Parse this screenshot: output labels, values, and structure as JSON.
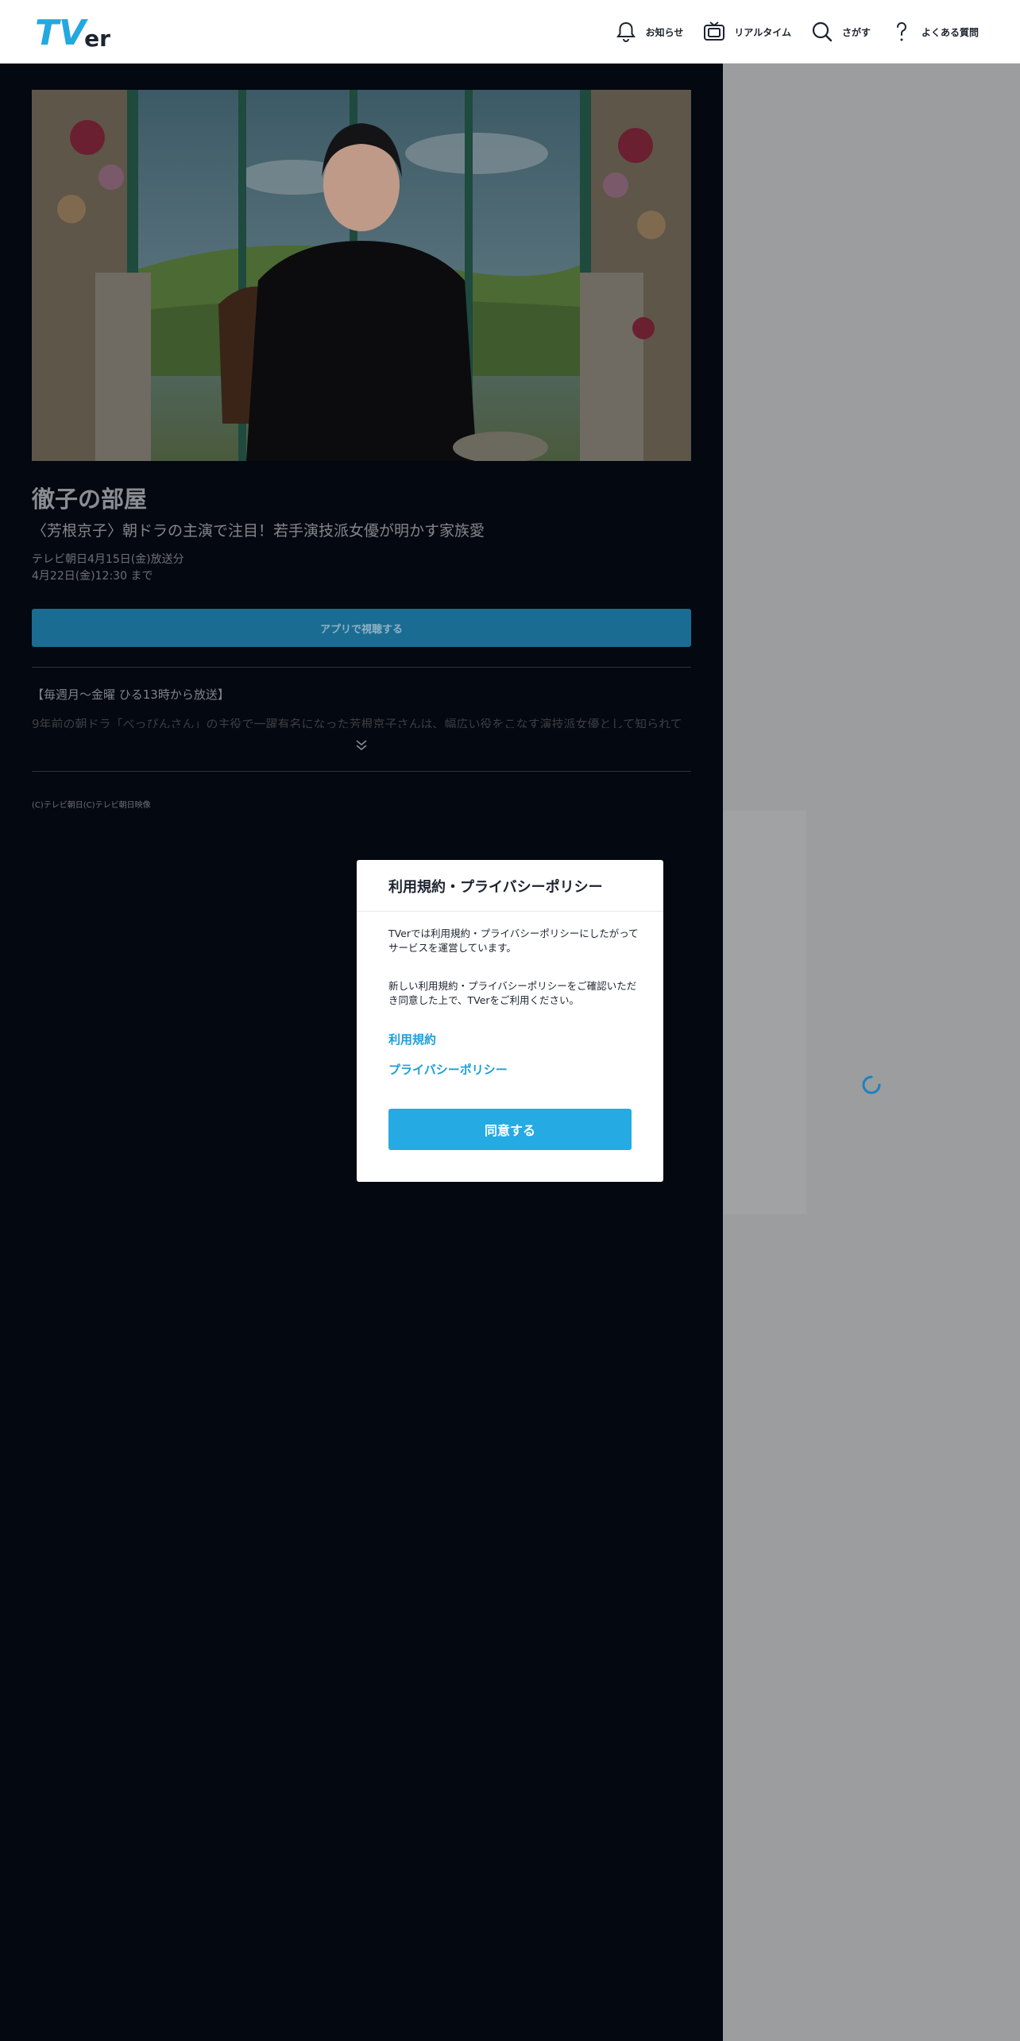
{
  "header": {
    "logo_main": "TV",
    "logo_sub": "er",
    "nav": [
      {
        "label": "お知らせ",
        "icon": "bell-icon"
      },
      {
        "label": "リアルタイム",
        "icon": "tv-icon"
      },
      {
        "label": "さがす",
        "icon": "search-icon"
      },
      {
        "label": "よくある質問",
        "icon": "question-icon"
      }
    ]
  },
  "episode": {
    "title": "徹子の部屋",
    "subtitle": "〈芳根京子〉朝ドラの主演で注目！若手演技派女優が明かす家族愛",
    "broadcast": "テレビ朝日4月15日(金)放送分",
    "available_until": "4月22日(金)12:30 まで",
    "cta_label": "アプリで視聴する",
    "description_heading": "【毎週月～金曜 ひる13時から放送】",
    "description_preview": "9年前の朝ドラ「べっぴんさん」の主役で一躍有名になった芳根京子さんは、幅広い役をこなす演技派女優として知られて",
    "copyright": "(C)テレビ朝日(C)テレビ朝日映像"
  },
  "modal": {
    "title": "利用規約・プライバシーポリシー",
    "paragraph1": "TVerでは利用規約・プライバシーポリシーにしたがってサービスを運営しています。",
    "paragraph2": "新しい利用規約・プライバシーポリシーをご確認いただき同意した上で、TVerをご利用ください。",
    "terms_link": "利用規約",
    "privacy_link": "プライバシーポリシー",
    "agree_button": "同意する"
  },
  "colors": {
    "brand_blue": "#25aae3",
    "dark_bg": "#030811"
  }
}
